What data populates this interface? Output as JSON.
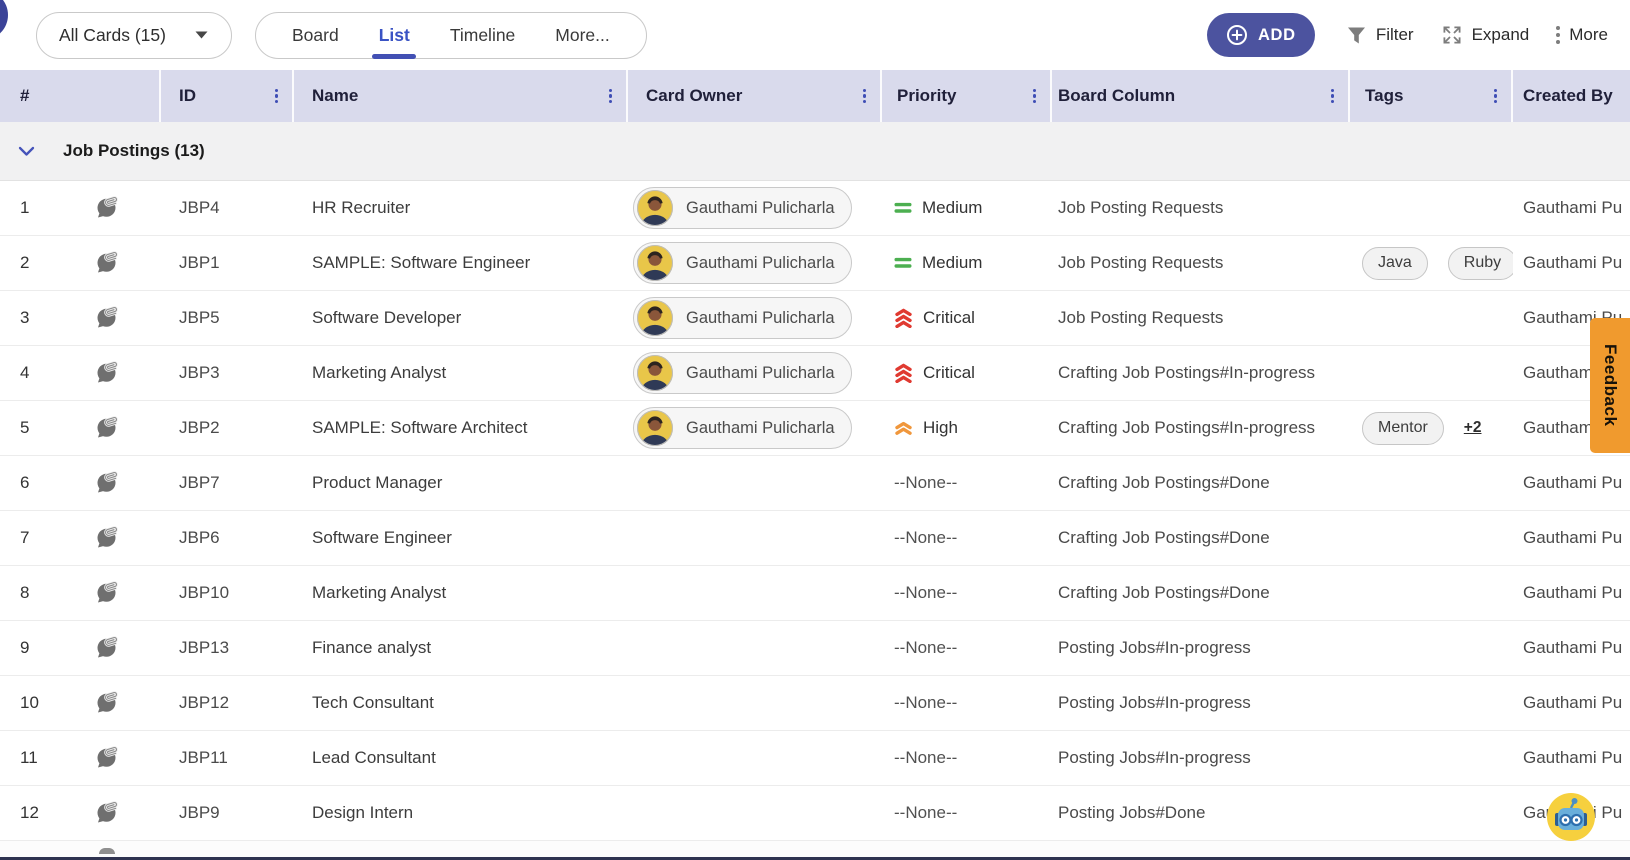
{
  "topbar": {
    "cards_filter": {
      "label": "All Cards (15)"
    },
    "view_tabs": [
      {
        "label": "Board",
        "active": false
      },
      {
        "label": "List",
        "active": true
      },
      {
        "label": "Timeline",
        "active": false
      },
      {
        "label": "More...",
        "active": false
      }
    ],
    "add_button": "ADD",
    "filter_label": "Filter",
    "expand_label": "Expand",
    "more_label": "More"
  },
  "table": {
    "columns": [
      {
        "key": "num",
        "label": "#",
        "has_menu": false
      },
      {
        "key": "id",
        "label": "ID",
        "has_menu": true
      },
      {
        "key": "name",
        "label": "Name",
        "has_menu": true
      },
      {
        "key": "owner",
        "label": "Card Owner",
        "has_menu": true
      },
      {
        "key": "priority",
        "label": "Priority",
        "has_menu": true
      },
      {
        "key": "board",
        "label": "Board Column",
        "has_menu": true
      },
      {
        "key": "tags",
        "label": "Tags",
        "has_menu": true
      },
      {
        "key": "created",
        "label": "Created By",
        "has_menu": false
      }
    ],
    "group": {
      "label": "Job Postings (13)"
    },
    "rows": [
      {
        "num": 1,
        "id": "JBP4",
        "name": "HR Recruiter",
        "owner": "Gauthami Pulicharla",
        "priority": {
          "level": "medium",
          "label": "Medium"
        },
        "board_column": "Job Posting Requests",
        "tags": [],
        "more_tags": "",
        "created_by": "Gauthami Pu"
      },
      {
        "num": 2,
        "id": "JBP1",
        "name": "SAMPLE: Software Engineer",
        "owner": "Gauthami Pulicharla",
        "priority": {
          "level": "medium",
          "label": "Medium"
        },
        "board_column": "Job Posting Requests",
        "tags": [
          "Java",
          "Ruby"
        ],
        "more_tags": "",
        "created_by": "Gauthami Pu"
      },
      {
        "num": 3,
        "id": "JBP5",
        "name": "Software Developer",
        "owner": "Gauthami Pulicharla",
        "priority": {
          "level": "critical",
          "label": "Critical"
        },
        "board_column": "Job Posting Requests",
        "tags": [],
        "more_tags": "",
        "created_by": "Gauthami Pu"
      },
      {
        "num": 4,
        "id": "JBP3",
        "name": "Marketing Analyst",
        "owner": "Gauthami Pulicharla",
        "priority": {
          "level": "critical",
          "label": "Critical"
        },
        "board_column": "Crafting Job Postings#In-progress",
        "tags": [],
        "more_tags": "",
        "created_by": "Gauthami Pu"
      },
      {
        "num": 5,
        "id": "JBP2",
        "name": "SAMPLE: Software Architect",
        "owner": "Gauthami Pulicharla",
        "priority": {
          "level": "high",
          "label": "High"
        },
        "board_column": "Crafting Job Postings#In-progress",
        "tags": [
          "Mentor"
        ],
        "more_tags": "+2",
        "created_by": "Gauthami Pu"
      },
      {
        "num": 6,
        "id": "JBP7",
        "name": "Product Manager",
        "owner": null,
        "priority": {
          "level": "none",
          "label": "--None--"
        },
        "board_column": "Crafting Job Postings#Done",
        "tags": [],
        "more_tags": "",
        "created_by": "Gauthami Pu"
      },
      {
        "num": 7,
        "id": "JBP6",
        "name": "Software Engineer",
        "owner": null,
        "priority": {
          "level": "none",
          "label": "--None--"
        },
        "board_column": "Crafting Job Postings#Done",
        "tags": [],
        "more_tags": "",
        "created_by": "Gauthami Pu"
      },
      {
        "num": 8,
        "id": "JBP10",
        "name": "Marketing Analyst",
        "owner": null,
        "priority": {
          "level": "none",
          "label": "--None--"
        },
        "board_column": "Crafting Job Postings#Done",
        "tags": [],
        "more_tags": "",
        "created_by": "Gauthami Pu"
      },
      {
        "num": 9,
        "id": "JBP13",
        "name": "Finance analyst",
        "owner": null,
        "priority": {
          "level": "none",
          "label": "--None--"
        },
        "board_column": "Posting Jobs#In-progress",
        "tags": [],
        "more_tags": "",
        "created_by": "Gauthami Pu"
      },
      {
        "num": 10,
        "id": "JBP12",
        "name": "Tech Consultant",
        "owner": null,
        "priority": {
          "level": "none",
          "label": "--None--"
        },
        "board_column": "Posting Jobs#In-progress",
        "tags": [],
        "more_tags": "",
        "created_by": "Gauthami Pu"
      },
      {
        "num": 11,
        "id": "JBP11",
        "name": "Lead Consultant",
        "owner": null,
        "priority": {
          "level": "none",
          "label": "--None--"
        },
        "board_column": "Posting Jobs#In-progress",
        "tags": [],
        "more_tags": "",
        "created_by": "Gauthami Pu"
      },
      {
        "num": 12,
        "id": "JBP9",
        "name": "Design Intern",
        "owner": null,
        "priority": {
          "level": "none",
          "label": "--None--"
        },
        "board_column": "Posting Jobs#Done",
        "tags": [],
        "more_tags": "",
        "created_by": "Gauthami Pu"
      }
    ]
  },
  "overlays": {
    "feedback_label": "Feedback"
  },
  "icons": {
    "attachment": "comment-paperclip-icon",
    "priority_medium": "equals-bars-icon",
    "priority_high": "double-chevron-up-icon",
    "priority_critical": "triple-chevron-up-icon",
    "assistant": "robot-icon"
  },
  "colors": {
    "accent": "#4c539f",
    "header_bg": "#d9daec",
    "tab_active": "#3a53c4",
    "priority_medium": "#4caf50",
    "priority_high": "#f0973c",
    "priority_critical": "#e03a31",
    "feedback_bg": "#f09a2e"
  }
}
